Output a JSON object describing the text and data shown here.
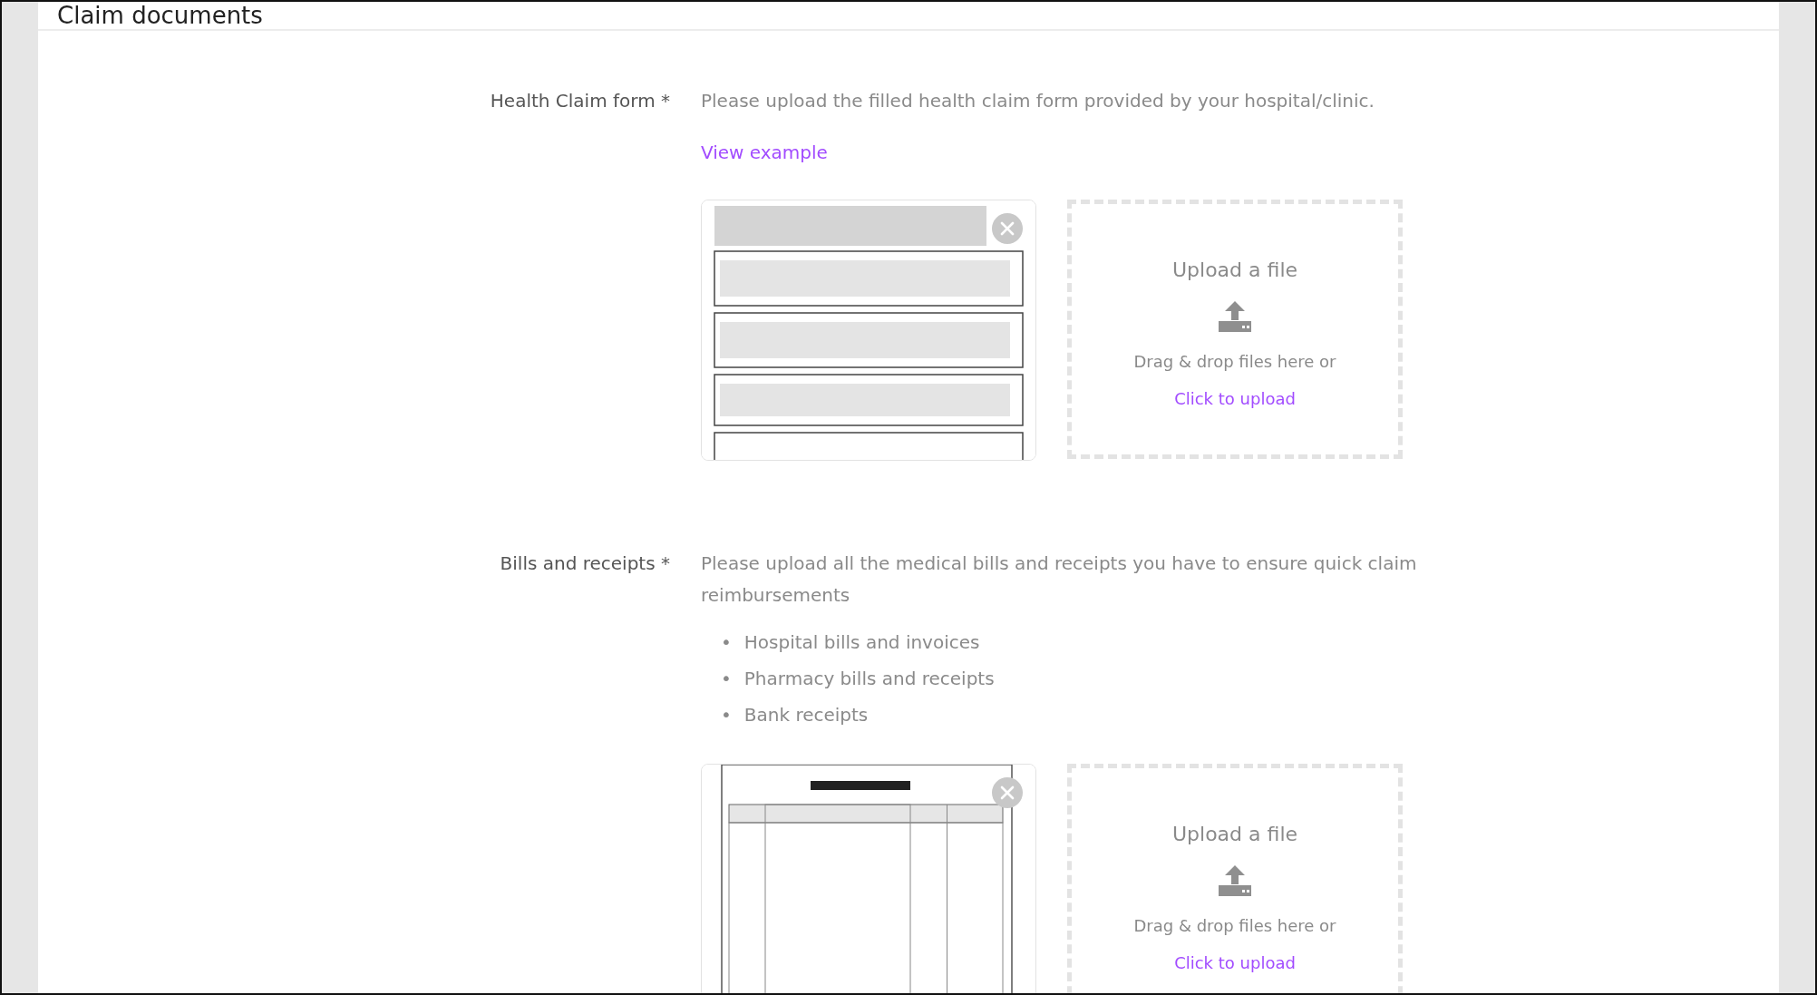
{
  "header": {
    "title": "Claim documents"
  },
  "sections": [
    {
      "label": "Health Claim form *",
      "description": "Please upload the filled health claim form provided by your hospital/clinic.",
      "link": "View example",
      "upload": {
        "title": "Upload a file",
        "hint": "Drag & drop files here or",
        "action": "Click to upload"
      }
    },
    {
      "label": "Bills and receipts *",
      "description": "Please upload all the medical bills and receipts you have to ensure quick claim reimbursements",
      "bullets": [
        {
          "marker": "•",
          "text": "Hospital bills and invoices"
        },
        {
          "marker": "•",
          "text": "Pharmacy bills and receipts"
        },
        {
          "marker": "•",
          "text": "Bank receipts"
        }
      ],
      "upload": {
        "title": "Upload a file",
        "hint": "Drag & drop files here or",
        "action": "Click to upload"
      }
    }
  ]
}
